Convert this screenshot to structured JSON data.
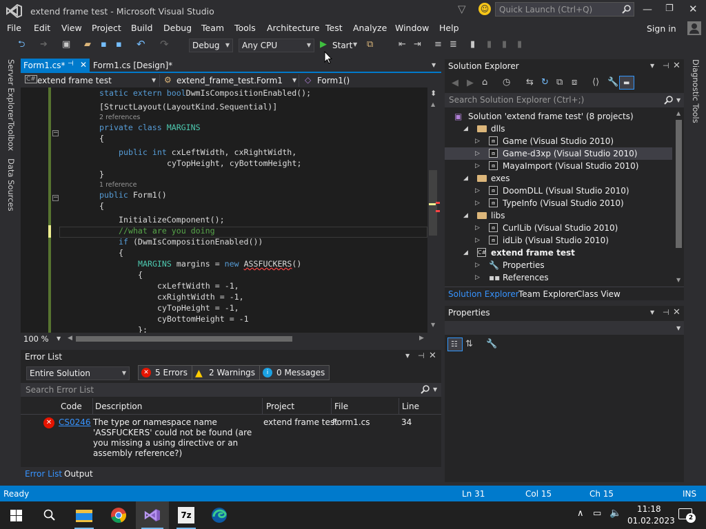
{
  "window": {
    "title": "extend frame test - Microsoft Visual Studio",
    "quick_launch_placeholder": "Quick Launch (Ctrl+Q)",
    "sign_in": "Sign in"
  },
  "menu": [
    "File",
    "Edit",
    "View",
    "Project",
    "Build",
    "Debug",
    "Team",
    "Tools",
    "Architecture",
    "Test",
    "Analyze",
    "Window",
    "Help"
  ],
  "toolbar": {
    "config": "Debug",
    "platform": "Any CPU",
    "start": "Start"
  },
  "side_tabs": [
    "Server Explorer",
    "Toolbox",
    "Data Sources"
  ],
  "right_side_tab": "Diagnostic Tools",
  "editor": {
    "tabs": [
      {
        "label": "Form1.cs*",
        "active": true
      },
      {
        "label": "Form1.cs [Design]*",
        "active": false
      }
    ],
    "nav": {
      "project": "extend frame test",
      "class": "extend_frame_test.Form1",
      "member": "Form1()"
    },
    "lines": [
      {
        "parts": [
          [
            "kw",
            "static extern "
          ],
          [
            "kw",
            "bool"
          ],
          [
            "",
            "DwmIsCompositionEnabled();"
          ]
        ],
        "indent": 8
      },
      {
        "parts": [
          [
            "",
            "[StructLayout(LayoutKind.Sequential)]"
          ]
        ],
        "indent": 8,
        "gap": true
      },
      {
        "ref": "2 references",
        "indent": 8
      },
      {
        "parts": [
          [
            "kw",
            "private class "
          ],
          [
            "ty",
            "MARGINS"
          ]
        ],
        "indent": 8
      },
      {
        "parts": [
          [
            "",
            "{"
          ]
        ],
        "indent": 8
      },
      {
        "parts": [
          [
            "kw",
            "public int "
          ],
          [
            "",
            "cxLeftWidth, cxRightWidth,"
          ]
        ],
        "indent": 12,
        "gap": true
      },
      {
        "parts": [
          [
            "",
            "cyTopHeight, cyBottomHeight;"
          ]
        ],
        "indent": 22
      },
      {
        "parts": [
          [
            "",
            "}"
          ]
        ],
        "indent": 8
      },
      {
        "ref": "1 reference",
        "indent": 8
      },
      {
        "parts": [
          [
            "kw",
            "public "
          ],
          [
            "",
            "Form1()"
          ]
        ],
        "indent": 8
      },
      {
        "parts": [
          [
            "",
            "{"
          ]
        ],
        "indent": 8
      },
      {
        "parts": [
          [
            "",
            "InitializeComponent();"
          ]
        ],
        "indent": 12,
        "gap": true
      },
      {
        "parts": [
          [
            "cm",
            "//what are you doing"
          ]
        ],
        "indent": 12,
        "current": true
      },
      {
        "parts": [
          [
            "kw",
            "if "
          ],
          [
            "",
            "(DwmIsCompositionEnabled())"
          ]
        ],
        "indent": 12
      },
      {
        "parts": [
          [
            "",
            "{"
          ]
        ],
        "indent": 12
      },
      {
        "parts": [
          [
            "ty",
            "MARGINS"
          ],
          [
            "",
            " margins = "
          ],
          [
            "kw",
            "new "
          ],
          [
            "sq",
            "ASSFUCKERS"
          ],
          [
            "",
            "()"
          ]
        ],
        "indent": 16
      },
      {
        "parts": [
          [
            "",
            "{"
          ]
        ],
        "indent": 16
      },
      {
        "parts": [
          [
            "",
            "cxLeftWidth = -1,"
          ]
        ],
        "indent": 20
      },
      {
        "parts": [
          [
            "",
            "cxRightWidth = -1,"
          ]
        ],
        "indent": 20
      },
      {
        "parts": [
          [
            "",
            "cyTopHeight = -1,"
          ]
        ],
        "indent": 20
      },
      {
        "parts": [
          [
            "",
            "cyBottomHeight = -1"
          ]
        ],
        "indent": 20
      },
      {
        "parts": [
          [
            "",
            "};"
          ]
        ],
        "indent": 16
      }
    ],
    "zoom": "100 %"
  },
  "error_list": {
    "title": "Error List",
    "scope": "Entire Solution",
    "errors": "5 Errors",
    "warnings": "2 Warnings",
    "messages": "0 Messages",
    "search_placeholder": "Search Error List",
    "columns": [
      "Code",
      "Description",
      "Project",
      "File",
      "Line"
    ],
    "rows": [
      {
        "code": "CS0246",
        "description": "The type or namespace name 'ASSFUCKERS' could not be found (are you missing a using directive or an assembly reference?)",
        "project": "extend frame test",
        "file": "Form1.cs",
        "line": "34"
      }
    ],
    "bottom_tabs": [
      "Error List",
      "Output"
    ]
  },
  "solution_explorer": {
    "title": "Solution Explorer",
    "search_placeholder": "Search Solution Explorer (Ctrl+;)",
    "items": [
      {
        "label": "Solution 'extend frame test' (8 projects)",
        "level": 0,
        "kind": "solution"
      },
      {
        "label": "dlls",
        "level": 1,
        "kind": "folder",
        "expanded": true
      },
      {
        "label": "Game (Visual Studio 2010)",
        "level": 2,
        "kind": "proj"
      },
      {
        "label": "Game-d3xp (Visual Studio 2010)",
        "level": 2,
        "kind": "proj",
        "selected": true
      },
      {
        "label": "MayaImport (Visual Studio 2010)",
        "level": 2,
        "kind": "proj"
      },
      {
        "label": "exes",
        "level": 1,
        "kind": "folder",
        "expanded": true
      },
      {
        "label": "DoomDLL (Visual Studio 2010)",
        "level": 2,
        "kind": "proj"
      },
      {
        "label": "TypeInfo (Visual Studio 2010)",
        "level": 2,
        "kind": "proj"
      },
      {
        "label": "libs",
        "level": 1,
        "kind": "folder",
        "expanded": true
      },
      {
        "label": "CurlLib (Visual Studio 2010)",
        "level": 2,
        "kind": "proj"
      },
      {
        "label": "idLib (Visual Studio 2010)",
        "level": 2,
        "kind": "proj"
      },
      {
        "label": "extend frame test",
        "level": 1,
        "kind": "cs",
        "expanded": true,
        "bold": true
      },
      {
        "label": "Properties",
        "level": 2,
        "kind": "wrench"
      },
      {
        "label": "References",
        "level": 2,
        "kind": "refs"
      }
    ],
    "bottom_tabs": [
      "Solution Explorer",
      "Team Explorer",
      "Class View"
    ]
  },
  "properties": {
    "title": "Properties"
  },
  "status": {
    "ready": "Ready",
    "ln": "Ln 31",
    "col": "Col 15",
    "ch": "Ch 15",
    "mode": "INS"
  },
  "taskbar": {
    "time": "11:18",
    "date": "01.02.2023",
    "apps": [
      "File Explorer",
      "Chrome",
      "Visual Studio",
      "7-Zip",
      "Edge"
    ]
  },
  "colors": {
    "accent": "#007acc",
    "background": "#2d2d30",
    "editor": "#1e1e1e"
  }
}
